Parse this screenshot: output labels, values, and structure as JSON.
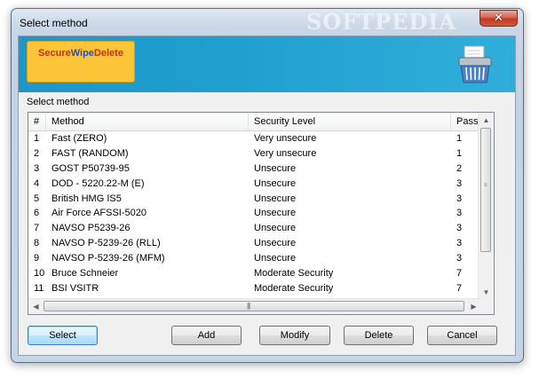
{
  "window": {
    "title": "Select method",
    "watermark": "SOFTPEDIA"
  },
  "banner": {
    "logo_part1": "Secure",
    "logo_part2": "Wipe",
    "logo_part3": "Delete"
  },
  "group_label": "Select method",
  "list": {
    "columns": [
      "#",
      "Method",
      "Security Level",
      "Passe"
    ],
    "rows": [
      [
        "1",
        "Fast (ZERO)",
        "Very unsecure",
        "1"
      ],
      [
        "2",
        "FAST (RANDOM)",
        "Very unsecure",
        "1"
      ],
      [
        "3",
        "GOST P50739-95",
        "Unsecure",
        "2"
      ],
      [
        "4",
        "DOD - 5220.22-M (E)",
        "Unsecure",
        "3"
      ],
      [
        "5",
        "British HMG IS5",
        "Unsecure",
        "3"
      ],
      [
        "6",
        "Air Force AFSSI-5020",
        "Unsecure",
        "3"
      ],
      [
        "7",
        "NAVSO P5239-26",
        "Unsecure",
        "3"
      ],
      [
        "8",
        "NAVSO P-5239-26 (RLL)",
        "Unsecure",
        "3"
      ],
      [
        "9",
        "NAVSO P-5239-26 (MFM)",
        "Unsecure",
        "3"
      ],
      [
        "10",
        "Bruce Schneier",
        "Moderate Security",
        "7"
      ],
      [
        "11",
        "BSI VSITR",
        "Moderate Security",
        "7"
      ]
    ]
  },
  "buttons": {
    "select": "Select",
    "add": "Add",
    "modify": "Modify",
    "delete": "Delete",
    "cancel": "Cancel"
  },
  "icons": {
    "close": "close-icon",
    "shredder": "shredder-icon",
    "scroll_up": "arrow-up-icon",
    "scroll_down": "arrow-down-icon",
    "scroll_left": "arrow-left-icon",
    "scroll_right": "arrow-right-icon"
  }
}
